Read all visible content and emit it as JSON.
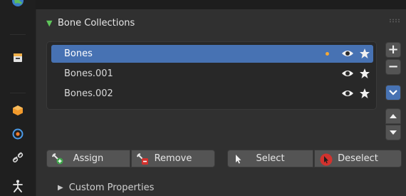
{
  "panel": {
    "title": "Bone Collections"
  },
  "collections": [
    {
      "name": "Bones",
      "active": true,
      "has_selected": true,
      "visible": true,
      "solo": true
    },
    {
      "name": "Bones.001",
      "active": false,
      "has_selected": false,
      "visible": true,
      "solo": true
    },
    {
      "name": "Bones.002",
      "active": false,
      "has_selected": false,
      "visible": true,
      "solo": true
    }
  ],
  "list_buttons": {
    "add": "+",
    "remove": "−"
  },
  "actions": {
    "assign": "Assign",
    "remove": "Remove",
    "select": "Select",
    "deselect": "Deselect"
  },
  "subpanel": {
    "custom_properties": "Custom Properties"
  },
  "icons": [
    "world-icon",
    "armature-data-icon",
    "object-icon",
    "physics-icon",
    "constraints-icon",
    "bone-icon",
    "eye-icon",
    "star-icon",
    "chevron-down-icon",
    "move-up-icon",
    "move-down-icon"
  ],
  "colors": {
    "accent": "#4772b3",
    "selected_dot": "#f4a836",
    "panel_tri": "#5fc55b"
  }
}
